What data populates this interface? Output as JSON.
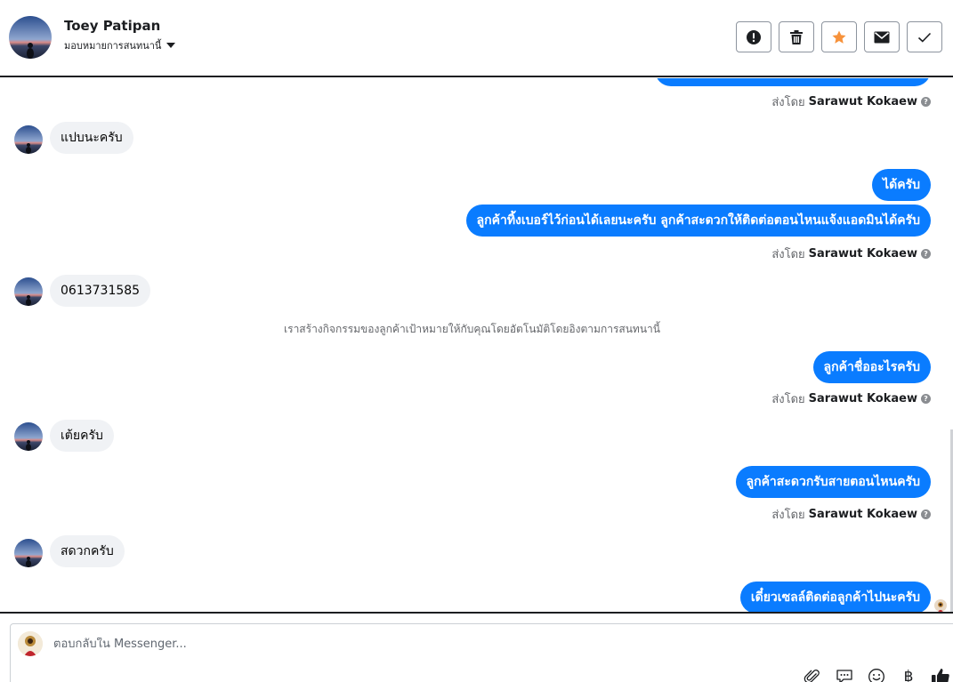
{
  "header": {
    "contact_name": "Toey Patipan",
    "assign_label": "มอบหมายการสนทนานี้",
    "actions": [
      {
        "icon": "alert-icon"
      },
      {
        "icon": "trash-icon"
      },
      {
        "icon": "star-icon",
        "color": "#f7923b"
      },
      {
        "icon": "envelope-icon"
      },
      {
        "icon": "check-icon"
      }
    ]
  },
  "conversation": {
    "sender_prefix": "ส่งโดย",
    "sender_name": "Sarawut Kokaew",
    "help_mark": "?",
    "messages": [
      {
        "type": "out",
        "text": ""
      },
      {
        "type": "in",
        "text": "แปบนะครับ"
      },
      {
        "type": "out",
        "text": "ได้ครับ"
      },
      {
        "type": "out",
        "text": "ลูกค้าทิ้งเบอร์ไว้ก่อนได้เลยนะครับ ลูกค้าสะดวกให้ติดต่อตอนไหนแจ้งแอดมินได้ครับ"
      },
      {
        "type": "in",
        "text": "0613731585"
      },
      {
        "type": "system",
        "text": "เราสร้างกิจกรรมของลูกค้าเป้าหมายให้กับคุณโดยอัตโนมัติโดยอิงตามการสนทนานี้"
      },
      {
        "type": "out",
        "text": "ลูกค้าชื่ออะไรครับ"
      },
      {
        "type": "in",
        "text": "เต้ยครับ"
      },
      {
        "type": "out",
        "text": "ลูกค้าสะดวกรับสายตอนไหนครับ"
      },
      {
        "type": "in",
        "text": "สดวกครับ"
      },
      {
        "type": "out",
        "text": "เดี๋ยวเซลล์ติดต่อลูกค้าไปนะครับ"
      }
    ]
  },
  "composer": {
    "placeholder": "ตอบกลับใน Messenger...",
    "tools": [
      "paperclip-icon",
      "chat-bubble-icon",
      "smiley-icon",
      "baht-icon",
      "thumbs-up-icon"
    ],
    "baht_symbol": "฿"
  },
  "colors": {
    "outgoing_bubble": "#0a7cff",
    "incoming_bubble": "#f0f2f5",
    "star": "#f7923b"
  }
}
